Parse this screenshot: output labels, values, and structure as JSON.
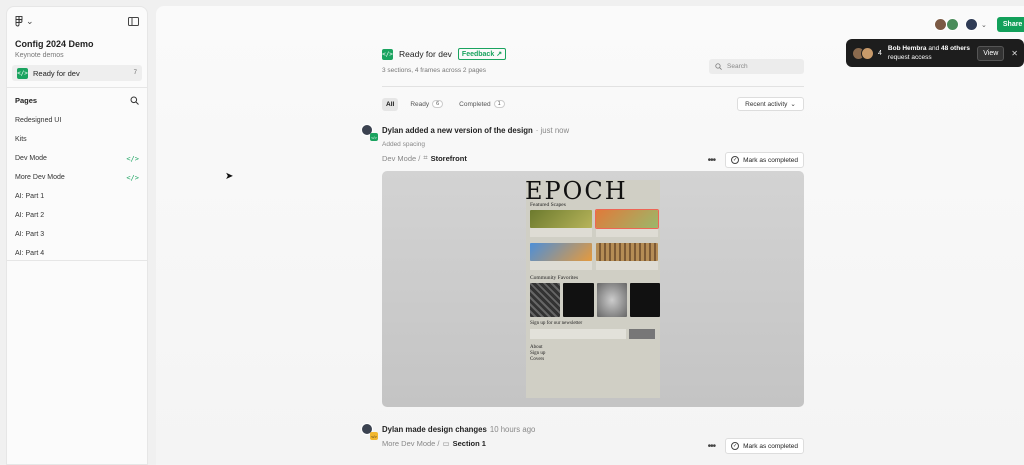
{
  "sidebar": {
    "project_title": "Config 2024 Demo",
    "project_sub": "Keynote demos",
    "ready": {
      "label": "Ready for dev",
      "count": "7"
    },
    "pages_header": "Pages",
    "pages": [
      {
        "label": "Redesigned UI",
        "code": ""
      },
      {
        "label": "Kits",
        "code": ""
      },
      {
        "label": "Dev Mode",
        "code": "</>"
      },
      {
        "label": "More Dev Mode",
        "code": "</>"
      },
      {
        "label": "AI: Part 1",
        "code": ""
      },
      {
        "label": "AI: Part 2",
        "code": ""
      },
      {
        "label": "AI: Part 3",
        "code": ""
      },
      {
        "label": "AI: Part 4",
        "code": ""
      }
    ]
  },
  "header": {
    "title": "Ready for dev",
    "feedback": "Feedback",
    "subtitle": "3 sections, 4 frames across 2 pages",
    "search_placeholder": "Search"
  },
  "tabs": [
    {
      "label": "All",
      "count": ""
    },
    {
      "label": "Ready",
      "count": "6"
    },
    {
      "label": "Completed",
      "count": "1"
    }
  ],
  "sort_label": "Recent activity",
  "activities": [
    {
      "title": "Dylan added a new version of the design",
      "time": "· just now",
      "note": "Added spacing",
      "crumb_parent": "Dev Mode /",
      "crumb_leaf": "Storefront",
      "mark_label": "Mark as completed"
    },
    {
      "title": "Dylan made design changes",
      "time": "10 hours ago",
      "note": "",
      "crumb_parent": "More Dev Mode /",
      "crumb_leaf": "Section 1",
      "mark_label": "Mark as completed"
    }
  ],
  "preview": {
    "headline": "EPOCH",
    "featured": "Featured Scapes",
    "community": "Community Favorites",
    "newsletter": "Sign up for our newsletter",
    "footer_links": [
      "About",
      "Sign up",
      "Covers"
    ]
  },
  "topbar": {
    "share_label": "Share",
    "toast_count": "4",
    "toast_name": "Bob Hembra",
    "toast_mid": "and",
    "toast_others": "48 others",
    "toast_rest": "request access",
    "toast_view": "View"
  },
  "colors": {
    "accent": "#1aa35f",
    "share": "#12a05a",
    "toast_bg": "#1d1d1d"
  }
}
